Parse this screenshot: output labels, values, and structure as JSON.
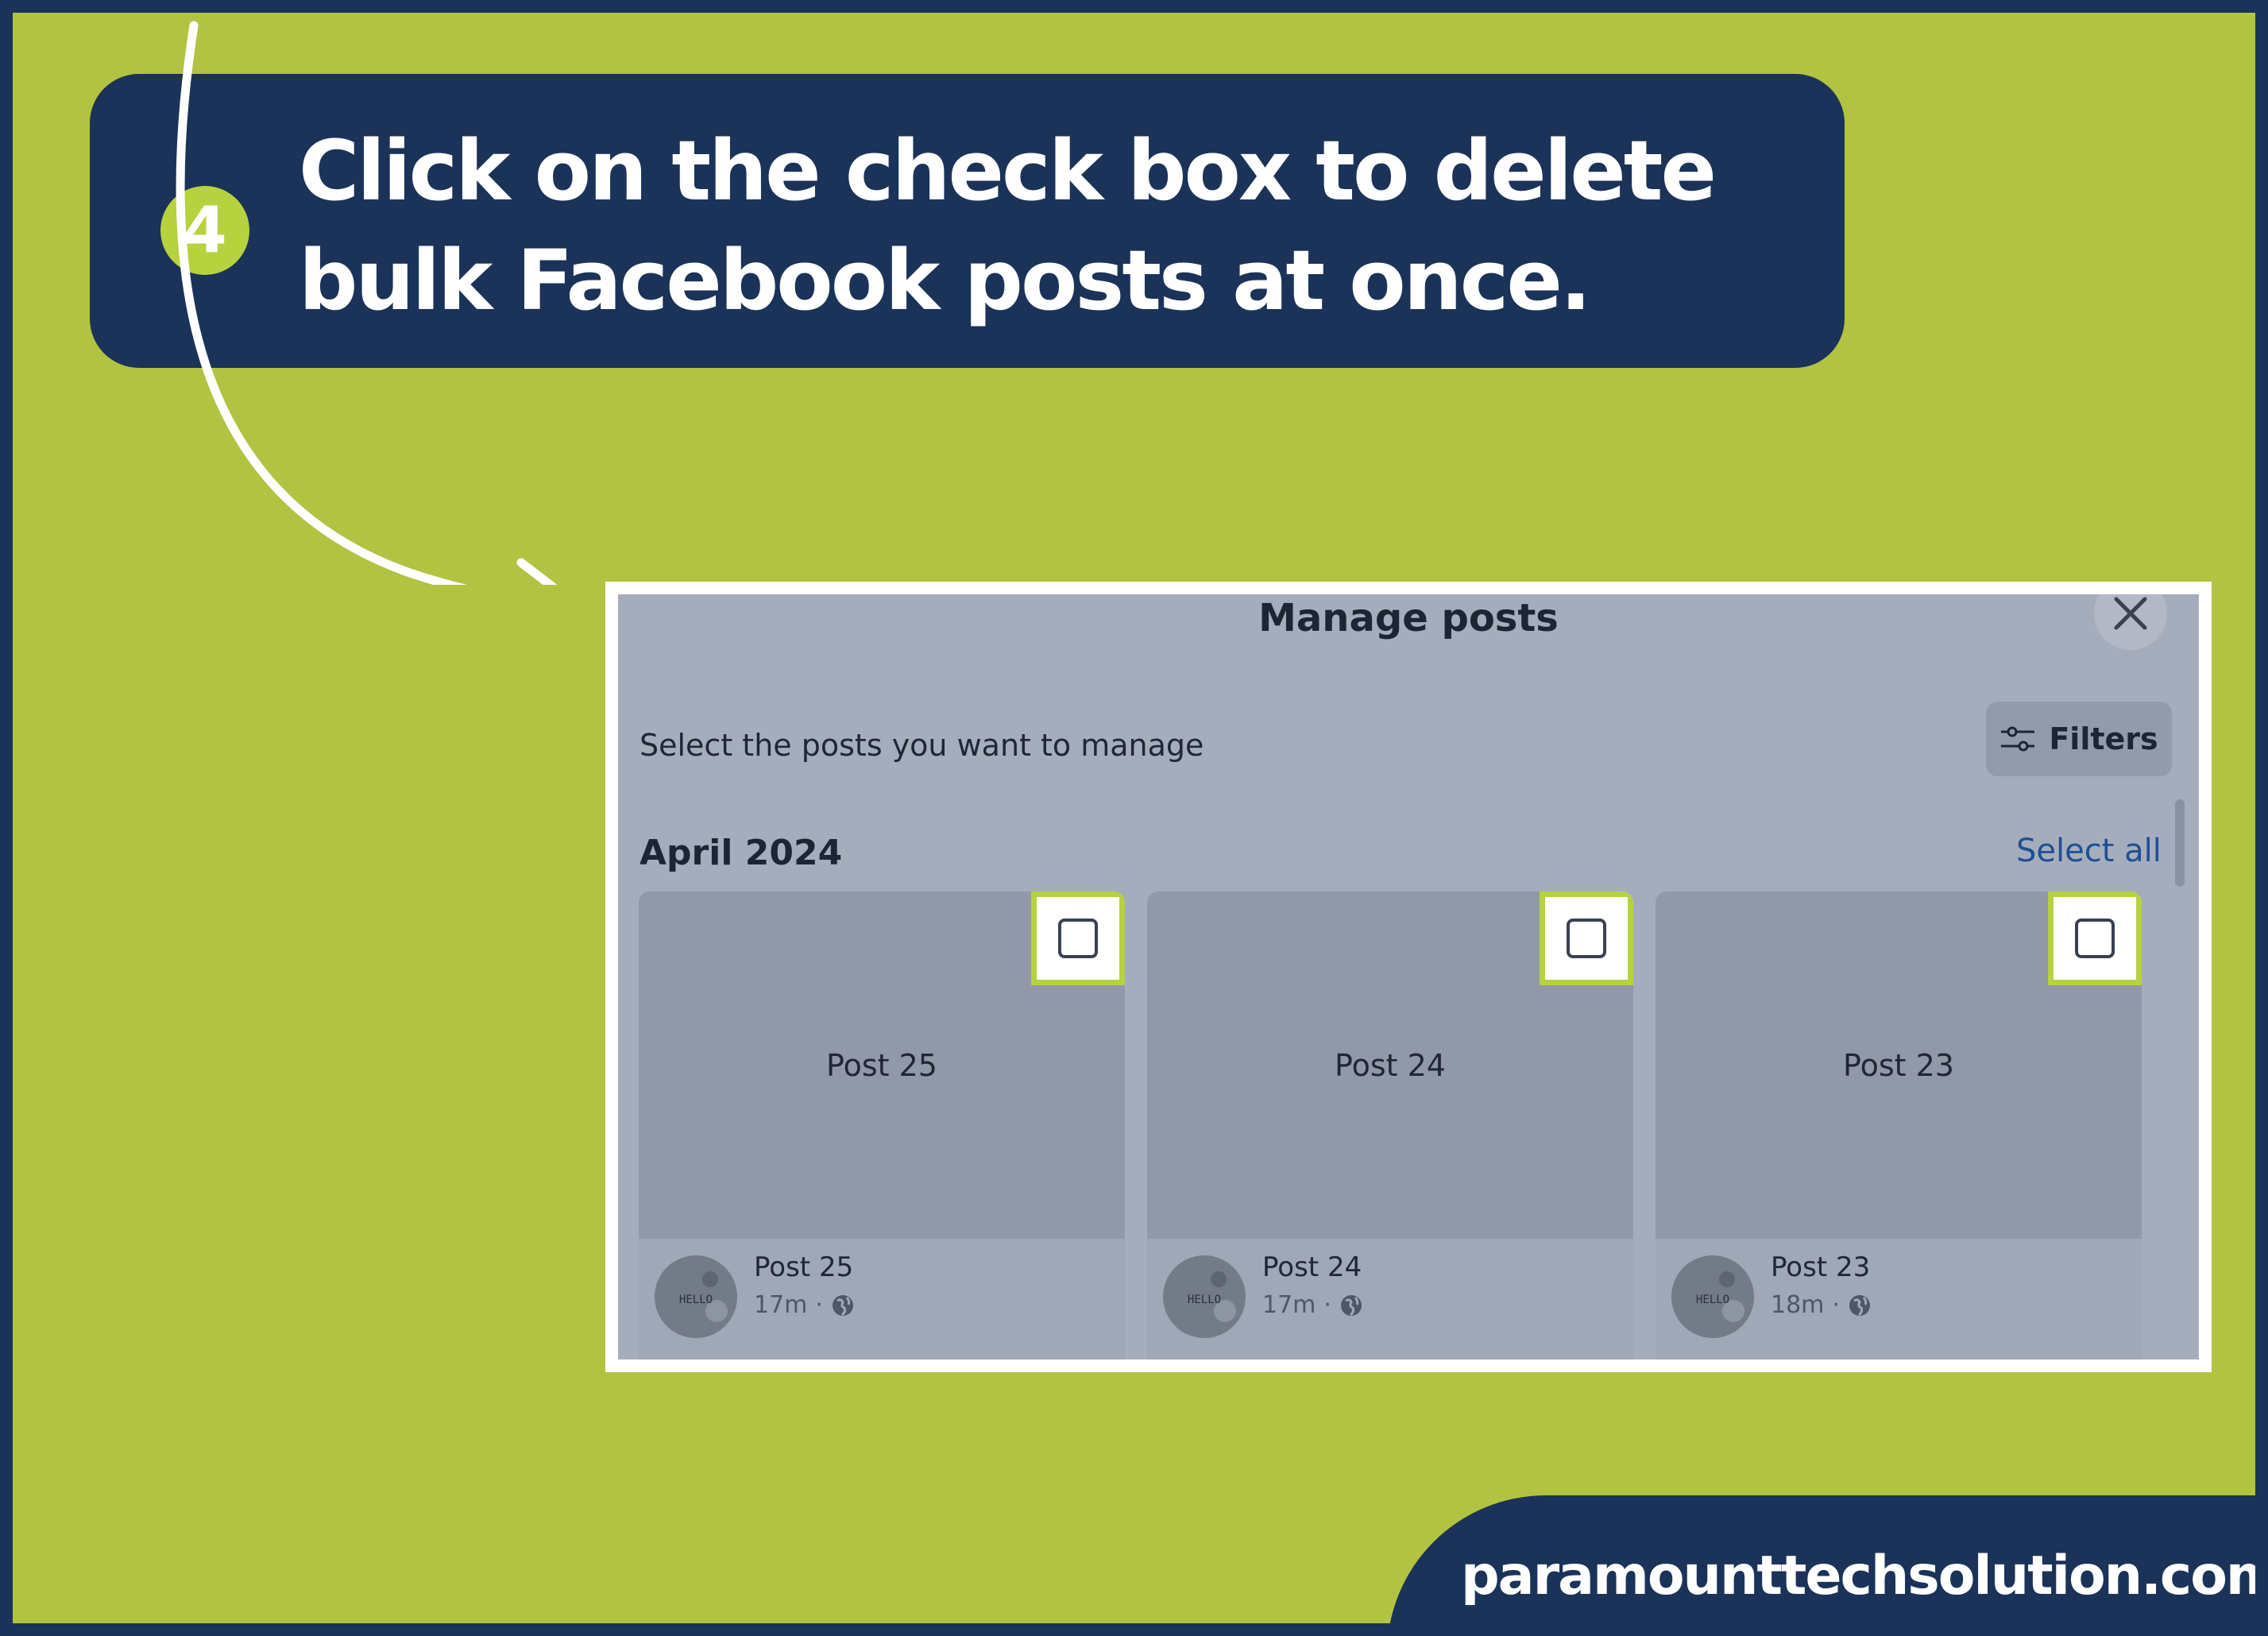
{
  "banner": {
    "step_number": "4",
    "instruction": "Click on the check box to delete bulk Facebook posts at once."
  },
  "dialog": {
    "title": "Manage posts",
    "subtitle": "Select the posts you want to manage",
    "filters_label": "Filters",
    "month": "April 2024",
    "select_all_label": "Select all",
    "posts": [
      {
        "preview": "Post 25",
        "name": "Post 25",
        "time": "17m",
        "separator": "·"
      },
      {
        "preview": "Post 24",
        "name": "Post 24",
        "time": "17m",
        "separator": "·"
      },
      {
        "preview": "Post 23",
        "name": "Post 23",
        "time": "18m",
        "separator": "·"
      }
    ],
    "avatar_text": "HELLO",
    "icons": [
      "close-icon",
      "filters-icon",
      "checkbox-icon",
      "globe-icon",
      "avatar-image"
    ]
  },
  "footer": {
    "website": "paramounttechsolution.com"
  },
  "colors": {
    "navy": "#1b3358",
    "lime_background": "#b2c341",
    "accent_green": "#b6d23f",
    "link_blue": "#1f4f94"
  }
}
